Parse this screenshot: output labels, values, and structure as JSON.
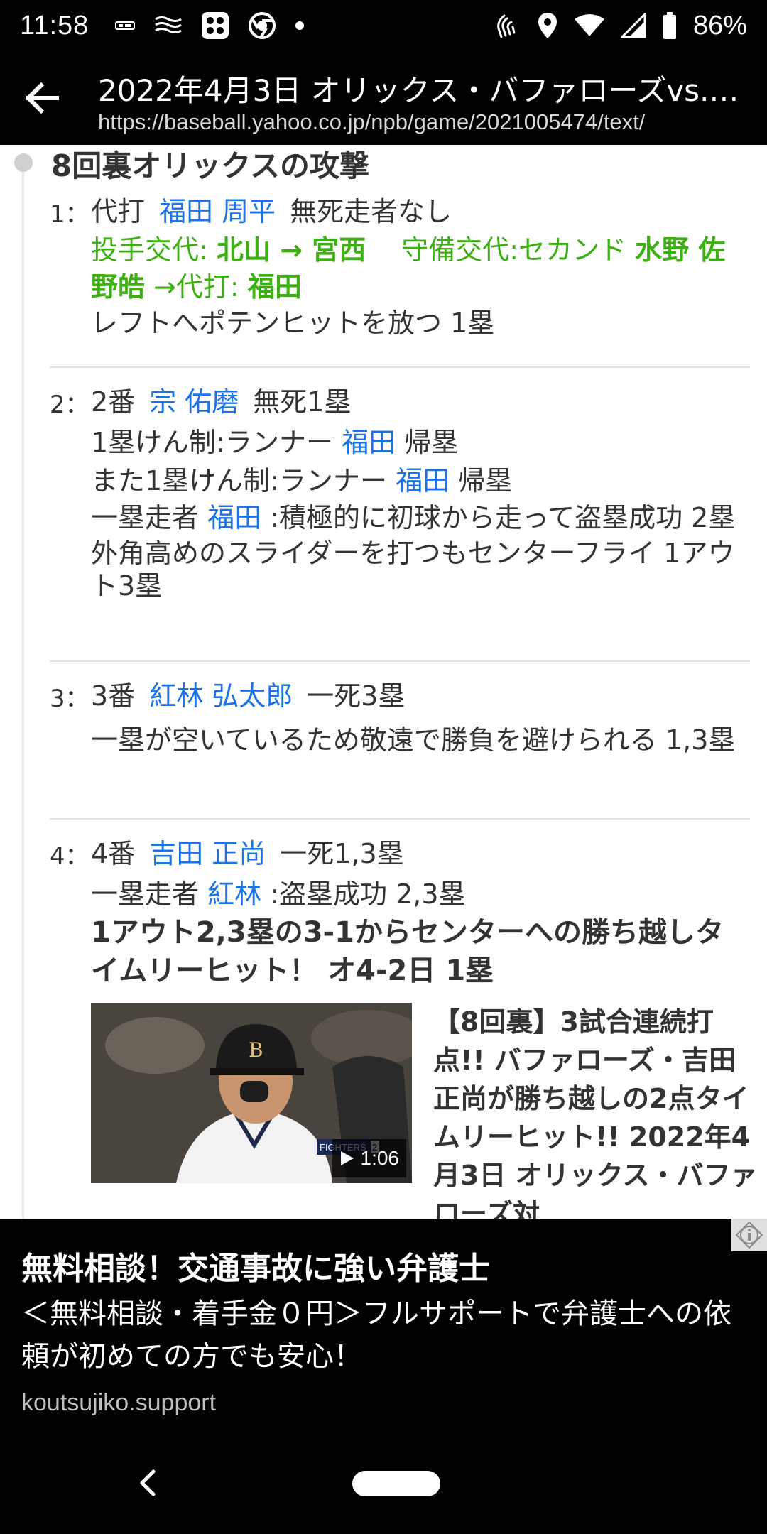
{
  "status_bar": {
    "time": "11:58",
    "battery_percent": "86%",
    "icons_left": [
      "notification-icon",
      "wave-icon",
      "app-grid-icon",
      "chrome-icon",
      "dot-icon"
    ],
    "icons_right": [
      "nfc-icon",
      "location-icon",
      "wifi-icon",
      "signal-icon",
      "battery-icon"
    ]
  },
  "titlebar": {
    "title": "2022年4月3日 オリックス・バファローズvs.…",
    "url": "https://baseball.yahoo.co.jp/npb/game/2021005474/text/"
  },
  "content": {
    "inning_title": "8回裏オリックスの攻撃",
    "plays": [
      {
        "num": "1：",
        "prefix": "代打",
        "batter": "福田 周平",
        "situation": "無死走者なし",
        "sub1_label": "投手交代: ",
        "sub1_names": "北山 → 宮西",
        "sub2_label": "守備交代:セカンド ",
        "sub2_names": "水野 佐野皓",
        "sub3_label": " →代打: ",
        "sub3_names": "福田",
        "result": "レフトへポテンヒットを放つ 1塁"
      },
      {
        "num": "2：",
        "prefix": "2番",
        "batter": "宗 佑磨",
        "situation": "無死1塁",
        "line1_a": "1塁けん制:ランナー ",
        "line1_name": "福田",
        "line1_b": " 帰塁",
        "line2_a": "また1塁けん制:ランナー ",
        "line2_name": "福田",
        "line2_b": " 帰塁",
        "line3_a": "一塁走者 ",
        "line3_name": "福田",
        "line3_b": " :積極的に初球から走って盗塁成功 2塁",
        "result": "外角高めのスライダーを打つもセンターフライ 1アウト3塁"
      },
      {
        "num": "3：",
        "prefix": "3番",
        "batter": "紅林 弘太郎",
        "situation": "一死3塁",
        "result": "一塁が空いているため敬遠で勝負を避けられる 1,3塁"
      },
      {
        "num": "4：",
        "prefix": "4番",
        "batter": "吉田 正尚",
        "situation": "一死1,3塁",
        "line1_a": "一塁走者 ",
        "line1_name": "紅林",
        "line1_b": " :盗塁成功 2,3塁",
        "result": "1アウト2,3塁の3-1からセンターへの勝ち越しタイムリーヒット！ オ4-2日 1塁",
        "video": {
          "duration": "1:06",
          "score_label": "FIGHTERS",
          "score_value": "2",
          "description": "【8回裏】3試合連続打点!! バファローズ・吉田正尚が勝ち越しの2点タイムリーヒット!! 2022年4月3日 オリックス・バファローズ対"
        }
      }
    ]
  },
  "ad": {
    "title": "無料相談！交通事故に強い弁護士",
    "body": "＜無料相談・着手金０円＞フルサポートで弁護士への依頼が初めての方でも安心！",
    "domain": "koutsujiko.support"
  },
  "colors": {
    "link_blue": "#1a73e8",
    "sub_green": "#3cb011",
    "text": "#333333"
  }
}
